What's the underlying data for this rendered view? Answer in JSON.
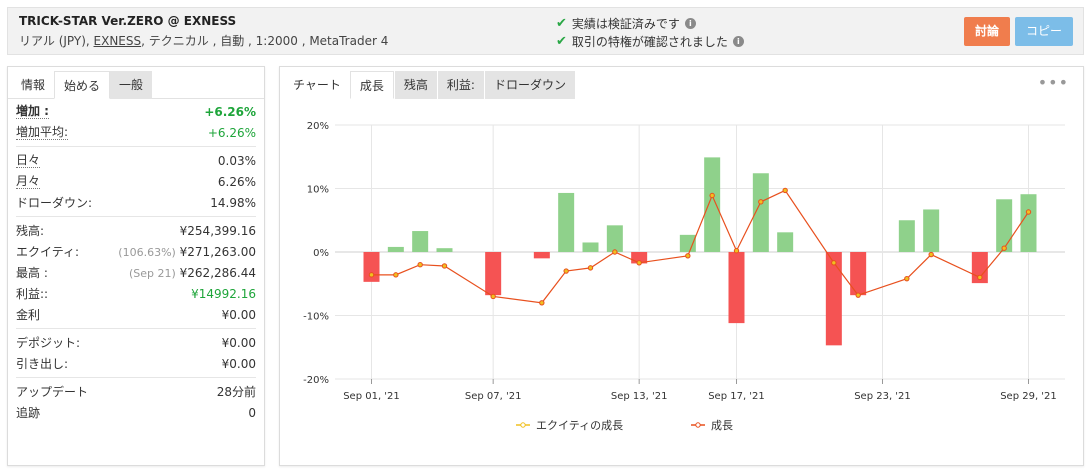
{
  "header": {
    "title": "TRICK-STAR Ver.ZERO @ EXNESS",
    "sub_pre": "リアル (JPY), ",
    "sub_broker": "EXNESS",
    "sub_post": ", テクニカル , 自動 , 1:2000 , MetaTrader 4",
    "verify1": "実績は検証済みです",
    "verify2": "取引の特権が確認されました",
    "discuss_label": "討論",
    "copy_label": "コピー"
  },
  "left_tabs": [
    "情報",
    "始める",
    "一般"
  ],
  "stats": {
    "gain_label": "増加 :",
    "gain_value": "+6.26%",
    "avg_gain_label": "増加平均:",
    "avg_gain_value": "+6.26%",
    "daily_label": "日々",
    "daily_value": "0.03%",
    "monthly_label": "月々",
    "monthly_value": "6.26%",
    "drawdown_label": "ドローダウン:",
    "drawdown_value": "14.98%",
    "balance_label": "残高:",
    "balance_value": "¥254,399.16",
    "equity_label": "エクイティ:",
    "equity_pct": "(106.63%)",
    "equity_value": "¥271,263.00",
    "highest_label": "最高 :",
    "highest_date": "(Sep 21)",
    "highest_value": "¥262,286.44",
    "profit_label": "利益::",
    "profit_value": "¥14992.16",
    "interest_label": "金利",
    "interest_value": "¥0.00",
    "deposits_label": "デポジット:",
    "deposits_value": "¥0.00",
    "withdrawals_label": "引き出し:",
    "withdrawals_value": "¥0.00",
    "updated_label": "アップデート",
    "updated_value": "28分前",
    "tracking_label": "追跡",
    "tracking_value": "0"
  },
  "right_tabs": [
    "チャート",
    "成長",
    "残高",
    "利益:",
    "ドローダウン"
  ],
  "colors": {
    "positive": "#8fd18b",
    "negative": "#f55353",
    "line": "#e8501e",
    "equity_line": "#f0c020",
    "accent_orange": "#f07d4d",
    "accent_blue": "#7cbde8"
  },
  "chart_data": {
    "type": "bar",
    "y_tick_labels": [
      "20%",
      "10%",
      "0%",
      "-10%",
      "-20%"
    ],
    "ylim": [
      -20,
      20
    ],
    "x_tick_labels": [
      "Sep 01, '21",
      "Sep 07, '21",
      "Sep 13, '21",
      "Sep 17, '21",
      "Sep 23, '21",
      "Sep 29, '21"
    ],
    "x_tick_index": [
      1,
      6,
      12,
      16,
      22,
      28
    ],
    "bars": [
      -4.7,
      0.8,
      3.3,
      0.6,
      -6.8,
      -1.0,
      9.3,
      1.5,
      4.2,
      -1.8,
      2.7,
      14.9,
      -11.2,
      12.4,
      3.1,
      -14.7,
      -6.8,
      5.0,
      6.7,
      -4.9,
      8.3,
      9.1
    ],
    "bar_index": [
      1,
      2,
      3,
      4,
      6,
      8,
      9,
      10,
      11,
      12,
      14,
      15,
      16,
      17,
      18,
      20,
      21,
      23,
      24,
      26,
      27,
      28
    ],
    "growth": [
      -3.6,
      -3.6,
      -2.0,
      -2.2,
      -7.0,
      -8.0,
      -3.0,
      -2.5,
      0.0,
      -1.7,
      -0.6,
      8.9,
      0.2,
      7.9,
      9.7,
      -1.7,
      -6.8,
      -4.2,
      -0.4,
      -4.0,
      0.6,
      6.3
    ],
    "series": [
      {
        "name": "エクイティの成長"
      },
      {
        "name": "成長"
      }
    ]
  }
}
